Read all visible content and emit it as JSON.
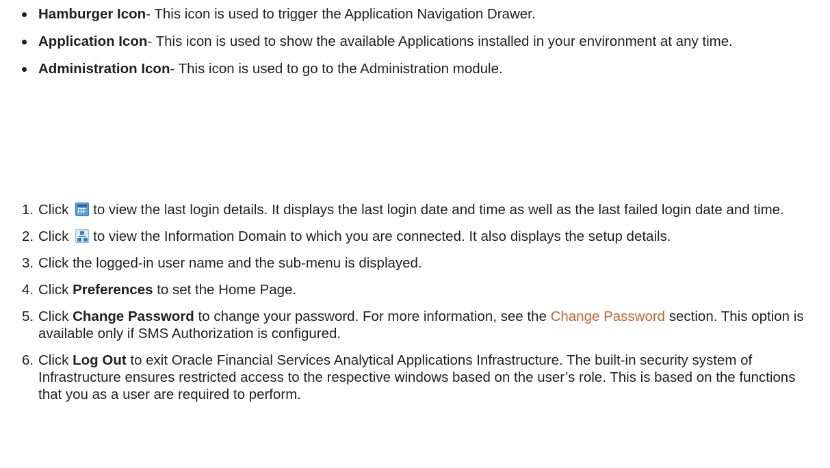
{
  "bullets": [
    {
      "term": "Hamburger Icon",
      "text": "- This icon is used to trigger the Application Navigation Drawer."
    },
    {
      "term": "Application Icon",
      "text": "- This icon is used to show the available Applications installed in your environment at any time."
    },
    {
      "term": "Administration Icon",
      "text": "- This icon is used to go to the Administration module."
    }
  ],
  "steps": [
    {
      "num": "1.",
      "pre": "Click",
      "icon": "calendar-icon",
      "post": "to view the last login details. It displays the last login date and time as well as the last failed login date and time."
    },
    {
      "num": "2.",
      "pre": "Click",
      "icon": "network-icon",
      "post": "to view the Information Domain to which you are connected. It also displays the setup details."
    },
    {
      "num": "3.",
      "text": "Click the logged-in user name and the sub-menu is displayed."
    },
    {
      "num": "4.",
      "pre": "Click ",
      "bold": "Preferences",
      "post": " to set the Home Page."
    },
    {
      "num": "5.",
      "pre": "Click ",
      "bold": "Change Password",
      "mid": " to change your password. For more information, see the ",
      "link": "Change Password",
      "post": " section. This option is available only if SMS Authorization is configured."
    },
    {
      "num": "6.",
      "pre": "Click ",
      "bold": "Log Out",
      "post": " to exit Oracle Financial Services Analytical Applications Infrastructure. The built-in security system of Infrastructure ensures restricted access to the respective windows based on the user’s role. This is based on the functions that you as a user are required to perform."
    }
  ]
}
